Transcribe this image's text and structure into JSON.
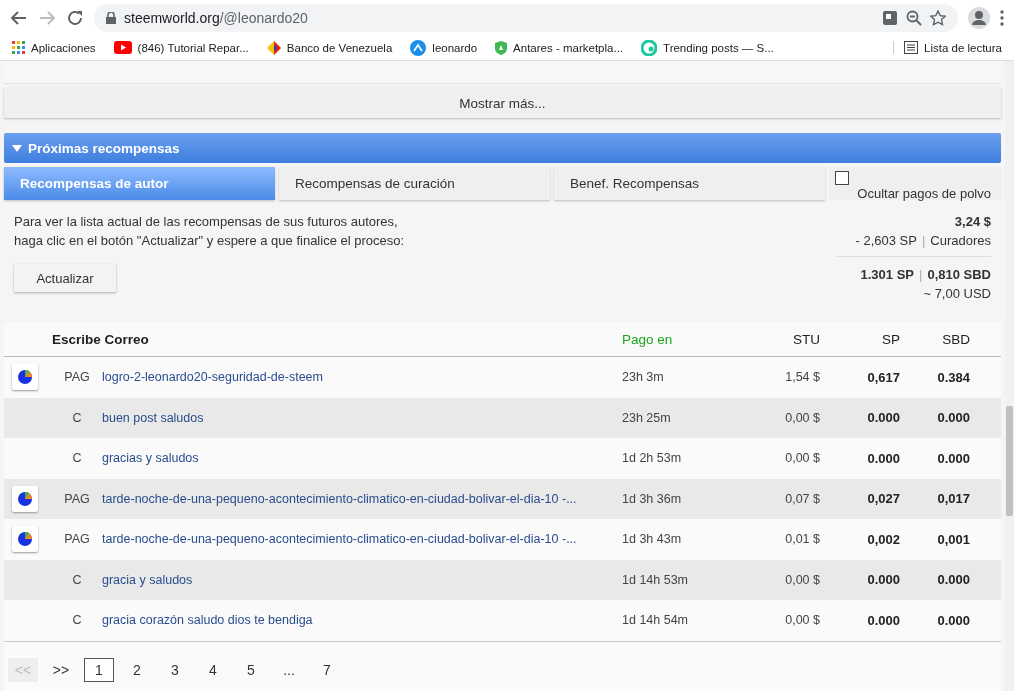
{
  "browser": {
    "url_host": "steemworld.org",
    "url_path": "/@leonardo20",
    "bookmarks": [
      {
        "label": "Aplicaciones",
        "kind": "apps"
      },
      {
        "label": "(846) Tutorial Repar...",
        "kind": "video"
      },
      {
        "label": "Banco de Venezuela",
        "kind": "bank"
      },
      {
        "label": "leonardo",
        "kind": "circle"
      },
      {
        "label": "Antares - marketpla...",
        "kind": "shield"
      },
      {
        "label": "Trending posts — S...",
        "kind": "swirl"
      }
    ],
    "reading_list": "Lista de lectura"
  },
  "show_more": "Mostrar más...",
  "section": {
    "title": "Próximas recompensas",
    "expanded": true
  },
  "tabs": [
    {
      "label": "Recompensas de autor",
      "selected": true
    },
    {
      "label": "Recompensas de curación",
      "selected": false
    },
    {
      "label": "Benef. Recompensas",
      "selected": false
    }
  ],
  "hide_dust": {
    "label": "Ocultar pagos de polvo",
    "checked": false
  },
  "info": [
    "Para ver la lista actual de las recompensas de sus futuros autores,",
    "haga clic en el botón \"Actualizar\" y espere a que finalice el proceso:"
  ],
  "update_button": "Actualizar",
  "totals": {
    "total": "3,24 $",
    "curators_sp": "- 2,603 SP",
    "curators_sep": "|",
    "curators_label": "Curadores",
    "amount_sep": "|",
    "sp": "1.301 SP",
    "sbd": "0,810 SBD",
    "usd": "~ 7,00 USD"
  },
  "table": {
    "columns": [
      "Escribe Correo",
      "Pago en",
      "STU",
      "SP",
      "SBD"
    ],
    "rows": [
      {
        "kind": "post",
        "type": "PAG",
        "title": "logro-2-leonardo20-seguridad-de-steem",
        "payout": "23h 3m",
        "stu": "1,54 $",
        "sp": "0,617",
        "sbd": "0.384"
      },
      {
        "kind": "comment",
        "type": "C",
        "title": "buen post saludos",
        "payout": "23h 25m",
        "stu": "0,00 $",
        "sp": "0.000",
        "sbd": "0.000"
      },
      {
        "kind": "comment",
        "type": "C",
        "title": "gracias y saludos",
        "payout": "1d 2h 53m",
        "stu": "0,00 $",
        "sp": "0.000",
        "sbd": "0.000"
      },
      {
        "kind": "post",
        "type": "PAG",
        "title": "tarde-noche-de-una-pequeno-acontecimiento-climatico-en-ciudad-bolivar-el-dia-10 -...",
        "payout": "1d 3h 36m",
        "stu": "0,07 $",
        "sp": "0,027",
        "sbd": "0,017"
      },
      {
        "kind": "post",
        "type": "PAG",
        "title": "tarde-noche-de-una-pequeno-acontecimiento-climatico-en-ciudad-bolivar-el-dia-10 -...",
        "payout": "1d 3h 43m",
        "stu": "0,01 $",
        "sp": "0,002",
        "sbd": "0,001"
      },
      {
        "kind": "comment",
        "type": "C",
        "title": "gracia y saludos",
        "payout": "1d 14h 53m",
        "stu": "0,00 $",
        "sp": "0.000",
        "sbd": "0.000"
      },
      {
        "kind": "comment",
        "type": "C",
        "title": "gracia corazón saludo dios te bendiga",
        "payout": "1d 14h 54m",
        "stu": "0,00 $",
        "sp": "0.000",
        "sbd": "0.000"
      }
    ]
  },
  "pagination": {
    "prev": {
      "label": "<<",
      "disabled": true
    },
    "next": {
      "label": ">>",
      "disabled": false
    },
    "pages": [
      {
        "label": "1",
        "selected": true
      },
      {
        "label": "2",
        "selected": false
      },
      {
        "label": "3",
        "selected": false
      },
      {
        "label": "4",
        "selected": false
      },
      {
        "label": "5",
        "selected": false
      },
      {
        "label": "...",
        "selected": false
      },
      {
        "label": "7",
        "selected": false
      }
    ]
  }
}
